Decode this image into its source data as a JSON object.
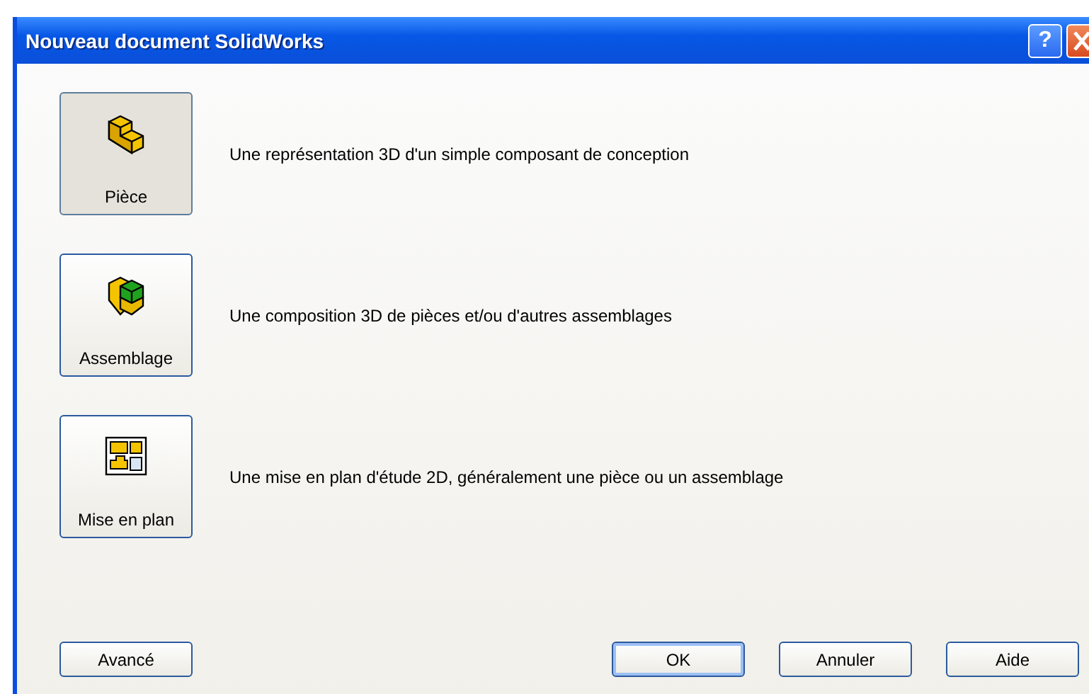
{
  "window": {
    "title": "Nouveau document SolidWorks",
    "help_button": "?"
  },
  "document_types": [
    {
      "kind": "part",
      "label": "Pièce",
      "selected": true,
      "description": "Une représentation 3D d'un simple composant de conception"
    },
    {
      "kind": "assembly",
      "label": "Assemblage",
      "selected": false,
      "description": "Une composition 3D de pièces et/ou d'autres assemblages"
    },
    {
      "kind": "drawing",
      "label": "Mise en plan",
      "selected": false,
      "description": "Une mise en plan d'étude 2D, généralement une pièce ou un assemblage"
    }
  ],
  "buttons": [
    {
      "label": "Avancé",
      "default": false
    },
    {
      "label": "OK",
      "default": true
    },
    {
      "label": "Annuler",
      "default": false
    },
    {
      "label": "Aide",
      "default": false
    }
  ]
}
